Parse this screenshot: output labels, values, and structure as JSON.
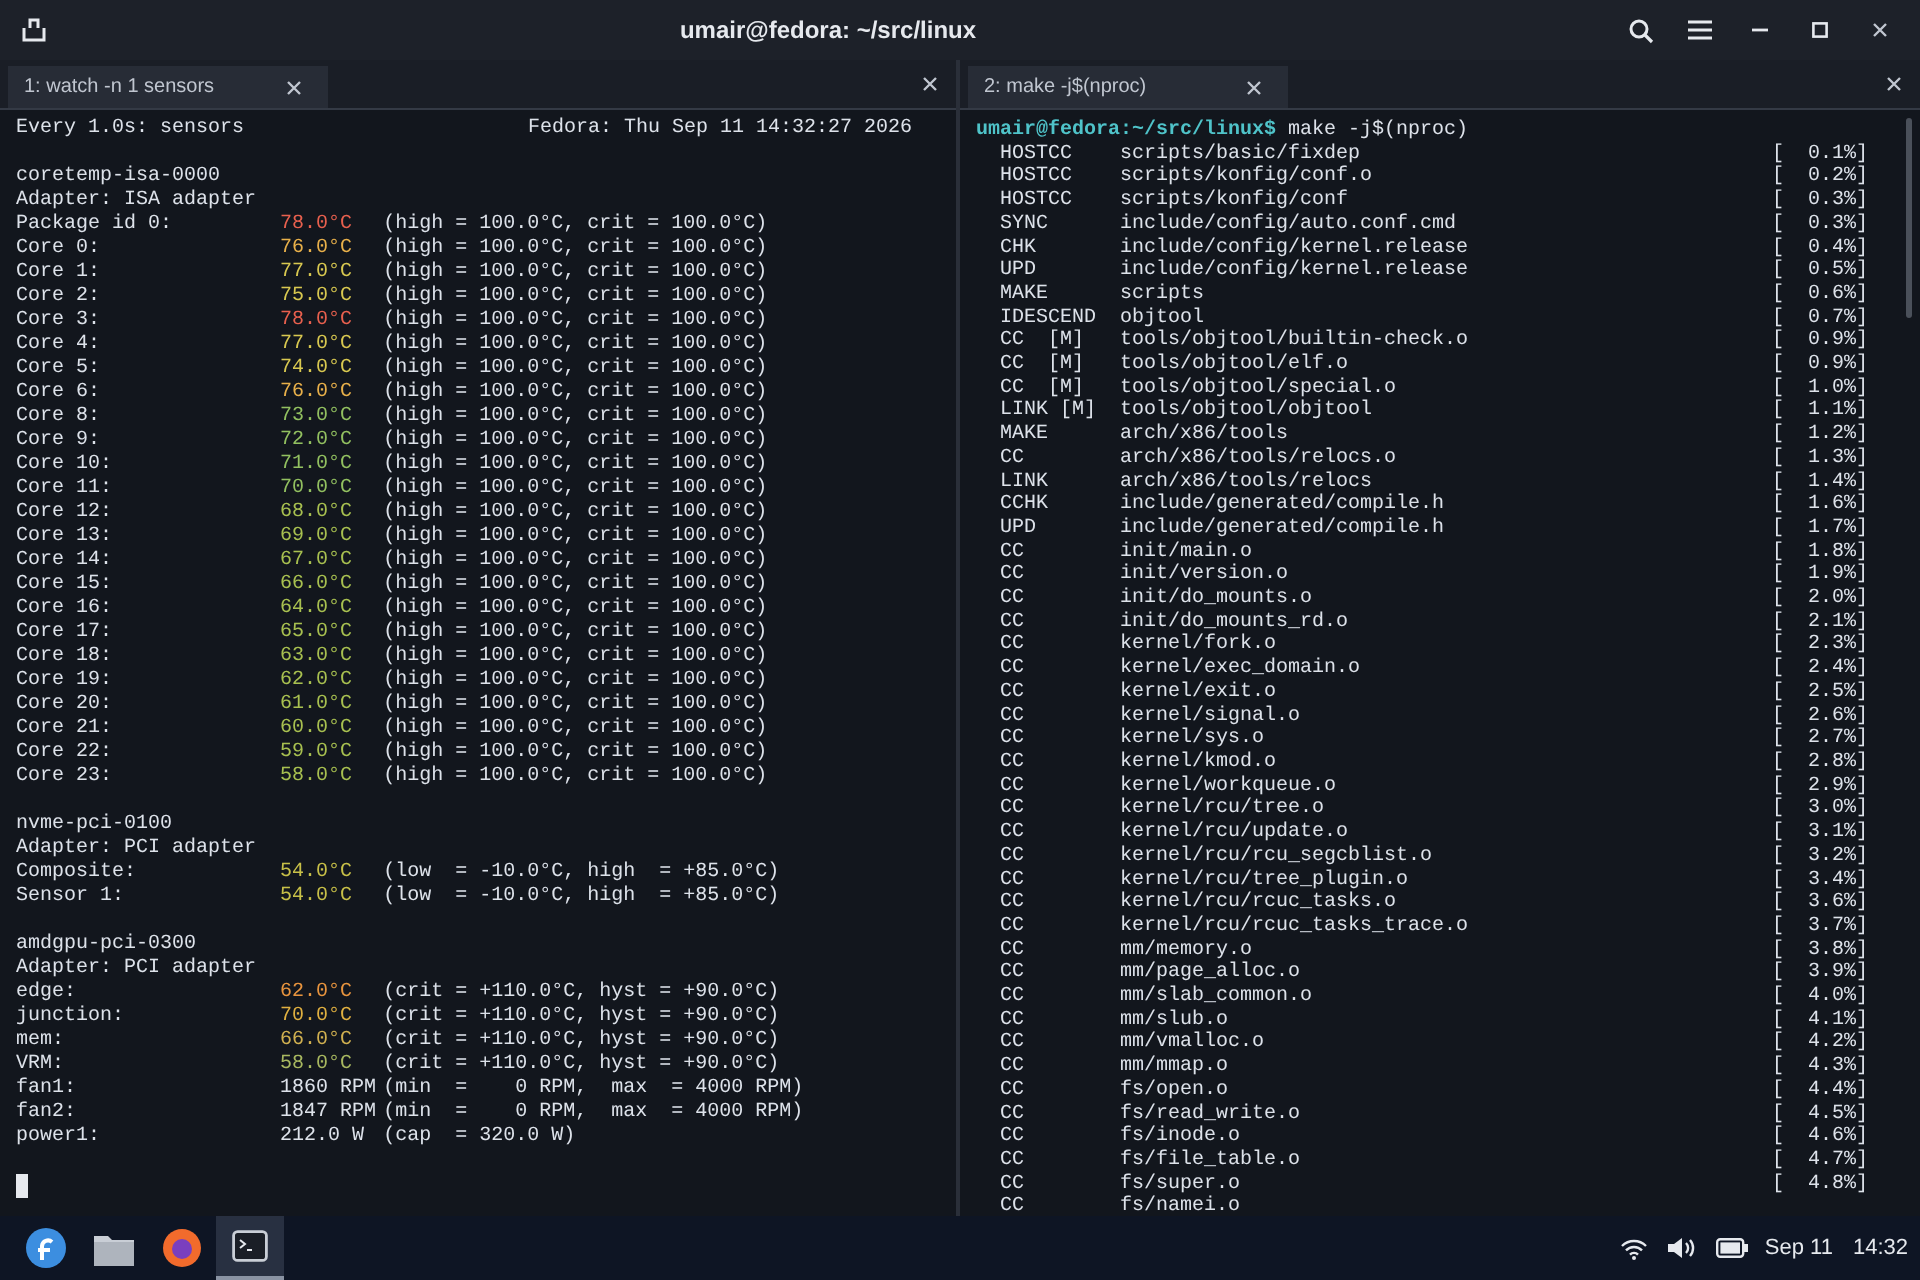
{
  "window": {
    "title": "umair@fedora: ~/src/linux"
  },
  "left_pane": {
    "tab": {
      "label": "1: watch -n 1 sensors"
    },
    "header": {
      "command": "Every 1.0s: sensors",
      "timestamp": "Fedora: Thu Sep 11 14:32:27 2026"
    },
    "sections": [
      {
        "chip": "coretemp-isa-0000",
        "adapter": "Adapter: ISA adapter",
        "readings": [
          {
            "label": "Package id 0:",
            "value": "78.0°C",
            "color": "#e8604e",
            "detail": "(high = 100.0°C, crit = 100.0°C)"
          },
          {
            "label": "Core 0:",
            "value": "76.0°C",
            "color": "#e8b04a",
            "detail": "(high = 100.0°C, crit = 100.0°C)"
          },
          {
            "label": "Core 1:",
            "value": "77.0°C",
            "color": "#d8c850",
            "detail": "(high = 100.0°C, crit = 100.0°C)"
          },
          {
            "label": "Core 2:",
            "value": "75.0°C",
            "color": "#d8c850",
            "detail": "(high = 100.0°C, crit = 100.0°C)"
          },
          {
            "label": "Core 3:",
            "value": "78.0°C",
            "color": "#e8604e",
            "detail": "(high = 100.0°C, crit = 100.0°C)"
          },
          {
            "label": "Core 4:",
            "value": "77.0°C",
            "color": "#d8c850",
            "detail": "(high = 100.0°C, crit = 100.0°C)"
          },
          {
            "label": "Core 5:",
            "value": "74.0°C",
            "color": "#d8c850",
            "detail": "(high = 100.0°C, crit = 100.0°C)"
          },
          {
            "label": "Core 6:",
            "value": "76.0°C",
            "color": "#e8b04a",
            "detail": "(high = 100.0°C, crit = 100.0°C)"
          },
          {
            "label": "Core 8:",
            "value": "73.0°C",
            "color": "#92c060",
            "detail": "(high = 100.0°C, crit = 100.0°C)"
          },
          {
            "label": "Core 9:",
            "value": "72.0°C",
            "color": "#92c060",
            "detail": "(high = 100.0°C, crit = 100.0°C)"
          },
          {
            "label": "Core 10:",
            "value": "71.0°C",
            "color": "#92c060",
            "detail": "(high = 100.0°C, crit = 100.0°C)"
          },
          {
            "label": "Core 11:",
            "value": "70.0°C",
            "color": "#92c060",
            "detail": "(high = 100.0°C, crit = 100.0°C)"
          },
          {
            "label": "Core 12:",
            "value": "68.0°C",
            "color": "#a8c050",
            "detail": "(high = 100.0°C, crit = 100.0°C)"
          },
          {
            "label": "Core 13:",
            "value": "69.0°C",
            "color": "#a8c050",
            "detail": "(high = 100.0°C, crit = 100.0°C)"
          },
          {
            "label": "Core 14:",
            "value": "67.0°C",
            "color": "#a8c050",
            "detail": "(high = 100.0°C, crit = 100.0°C)"
          },
          {
            "label": "Core 15:",
            "value": "66.0°C",
            "color": "#a8c050",
            "detail": "(high = 100.0°C, crit = 100.0°C)"
          },
          {
            "label": "Core 16:",
            "value": "64.0°C",
            "color": "#a8c050",
            "detail": "(high = 100.0°C, crit = 100.0°C)"
          },
          {
            "label": "Core 17:",
            "value": "65.0°C",
            "color": "#a8c050",
            "detail": "(high = 100.0°C, crit = 100.0°C)"
          },
          {
            "label": "Core 18:",
            "value": "63.0°C",
            "color": "#a8c050",
            "detail": "(high = 100.0°C, crit = 100.0°C)"
          },
          {
            "label": "Core 19:",
            "value": "62.0°C",
            "color": "#a8c050",
            "detail": "(high = 100.0°C, crit = 100.0°C)"
          },
          {
            "label": "Core 20:",
            "value": "61.0°C",
            "color": "#a8c050",
            "detail": "(high = 100.0°C, crit = 100.0°C)"
          },
          {
            "label": "Core 21:",
            "value": "60.0°C",
            "color": "#a8c050",
            "detail": "(high = 100.0°C, crit = 100.0°C)"
          },
          {
            "label": "Core 22:",
            "value": "59.0°C",
            "color": "#a8c050",
            "detail": "(high = 100.0°C, crit = 100.0°C)"
          },
          {
            "label": "Core 23:",
            "value": "58.0°C",
            "color": "#a8c050",
            "detail": "(high = 100.0°C, crit = 100.0°C)"
          }
        ]
      },
      {
        "chip": "nvme-pci-0100",
        "adapter": "Adapter: PCI adapter",
        "readings": [
          {
            "label": "Composite:",
            "value": "54.0°C",
            "color": "#c8c048",
            "detail": "(low  = -10.0°C, high  = +85.0°C)"
          },
          {
            "label": "Sensor 1:",
            "value": "54.0°C",
            "color": "#c8c048",
            "detail": "(low  = -10.0°C, high  = +85.0°C)"
          }
        ]
      },
      {
        "chip": "amdgpu-pci-0300",
        "adapter": "Adapter: PCI adapter",
        "readings": [
          {
            "label": "edge:",
            "value": "62.0°C",
            "color": "#e8943e",
            "detail": "(crit = +110.0°C, hyst = +90.0°C)"
          },
          {
            "label": "junction:",
            "value": "70.0°C",
            "color": "#e0b040",
            "detail": "(crit = +110.0°C, hyst = +90.0°C)"
          },
          {
            "label": "mem:",
            "value": "66.0°C",
            "color": "#d0b050",
            "detail": "(crit = +110.0°C, hyst = +90.0°C)"
          },
          {
            "label": "VRM:",
            "value": "58.0°C",
            "color": "#a8b860",
            "detail": "(crit = +110.0°C, hyst = +90.0°C)"
          },
          {
            "label": "fan1:",
            "value": "1860 RPM",
            "detail": "(min  =    0 RPM,  max  = 4000 RPM)"
          },
          {
            "label": "fan2:",
            "value": "1847 RPM",
            "detail": "(min  =    0 RPM,  max  = 4000 RPM)"
          },
          {
            "label": "power1:",
            "value": "212.0 W",
            "detail": "(cap  = 320.0 W)"
          }
        ]
      }
    ]
  },
  "right_pane": {
    "tab": {
      "label": "2: make -j$(nproc)"
    },
    "prompt": "umair@fedora:~/src/linux$",
    "command": "make -j$(nproc)",
    "lines": [
      {
        "tag": "HOSTCC",
        "path": "scripts/basic/fixdep",
        "progress": "[  0.1%]"
      },
      {
        "tag": "HOSTCC",
        "path": "scripts/konfig/conf.o",
        "progress": "[  0.2%]"
      },
      {
        "tag": "HOSTCC",
        "path": "scripts/konfig/conf",
        "progress": "[  0.3%]"
      },
      {
        "tag": "SYNC",
        "path": "include/config/auto.conf.cmd",
        "progress": "[  0.3%]"
      },
      {
        "tag": "CHK",
        "path": "include/config/kernel.release",
        "progress": "[  0.4%]"
      },
      {
        "tag": "UPD",
        "path": "include/config/kernel.release",
        "progress": "[  0.5%]"
      },
      {
        "tag": "MAKE",
        "path": "scripts",
        "progress": "[  0.6%]"
      },
      {
        "tag": "IDESCEND",
        "path": "objtool",
        "progress": "[  0.7%]"
      },
      {
        "tag": "CC  [M]",
        "path": "tools/objtool/builtin-check.o",
        "progress": "[  0.9%]"
      },
      {
        "tag": "CC  [M]",
        "path": "tools/objtool/elf.o",
        "progress": "[  0.9%]"
      },
      {
        "tag": "CC  [M]",
        "path": "tools/objtool/special.o",
        "progress": "[  1.0%]"
      },
      {
        "tag": "LINK [M]",
        "path": "tools/objtool/objtool",
        "progress": "[  1.1%]"
      },
      {
        "tag": "MAKE",
        "path": "arch/x86/tools",
        "progress": "[  1.2%]"
      },
      {
        "tag": "CC",
        "path": "arch/x86/tools/relocs.o",
        "progress": "[  1.3%]"
      },
      {
        "tag": "LINK",
        "path": "arch/x86/tools/relocs",
        "progress": "[  1.4%]"
      },
      {
        "tag": "CCHK",
        "path": "include/generated/compile.h",
        "progress": "[  1.6%]"
      },
      {
        "tag": "UPD",
        "path": "include/generated/compile.h",
        "progress": "[  1.7%]"
      },
      {
        "tag": "CC",
        "path": "init/main.o",
        "progress": "[  1.8%]"
      },
      {
        "tag": "CC",
        "path": "init/version.o",
        "progress": "[  1.9%]"
      },
      {
        "tag": "CC",
        "path": "init/do_mounts.o",
        "progress": "[  2.0%]"
      },
      {
        "tag": "CC",
        "path": "init/do_mounts_rd.o",
        "progress": "[  2.1%]"
      },
      {
        "tag": "CC",
        "path": "kernel/fork.o",
        "progress": "[  2.3%]"
      },
      {
        "tag": "CC",
        "path": "kernel/exec_domain.o",
        "progress": "[  2.4%]"
      },
      {
        "tag": "CC",
        "path": "kernel/exit.o",
        "progress": "[  2.5%]"
      },
      {
        "tag": "CC",
        "path": "kernel/signal.o",
        "progress": "[  2.6%]"
      },
      {
        "tag": "CC",
        "path": "kernel/sys.o",
        "progress": "[  2.7%]"
      },
      {
        "tag": "CC",
        "path": "kernel/kmod.o",
        "progress": "[  2.8%]"
      },
      {
        "tag": "CC",
        "path": "kernel/workqueue.o",
        "progress": "[  2.9%]"
      },
      {
        "tag": "CC",
        "path": "kernel/rcu/tree.o",
        "progress": "[  3.0%]"
      },
      {
        "tag": "CC",
        "path": "kernel/rcu/update.o",
        "progress": "[  3.1%]"
      },
      {
        "tag": "CC",
        "path": "kernel/rcu/rcu_segcblist.o",
        "progress": "[  3.2%]"
      },
      {
        "tag": "CC",
        "path": "kernel/rcu/tree_plugin.o",
        "progress": "[  3.4%]"
      },
      {
        "tag": "CC",
        "path": "kernel/rcu/rcuc_tasks.o",
        "progress": "[  3.6%]"
      },
      {
        "tag": "CC",
        "path": "kernel/rcu/rcuc_tasks_trace.o",
        "progress": "[  3.7%]"
      },
      {
        "tag": "CC",
        "path": "mm/memory.o",
        "progress": "[  3.8%]"
      },
      {
        "tag": "CC",
        "path": "mm/page_alloc.o",
        "progress": "[  3.9%]"
      },
      {
        "tag": "CC",
        "path": "mm/slab_common.o",
        "progress": "[  4.0%]"
      },
      {
        "tag": "CC",
        "path": "mm/slub.o",
        "progress": "[  4.1%]"
      },
      {
        "tag": "CC",
        "path": "mm/vmalloc.o",
        "progress": "[  4.2%]"
      },
      {
        "tag": "CC",
        "path": "mm/mmap.o",
        "progress": "[  4.3%]"
      },
      {
        "tag": "CC",
        "path": "fs/open.o",
        "progress": "[  4.4%]"
      },
      {
        "tag": "CC",
        "path": "fs/read_write.o",
        "progress": "[  4.5%]"
      },
      {
        "tag": "CC",
        "path": "fs/inode.o",
        "progress": "[  4.6%]"
      },
      {
        "tag": "CC",
        "path": "fs/file_table.o",
        "progress": "[  4.7%]"
      },
      {
        "tag": "CC",
        "path": "fs/super.o",
        "progress": "[  4.8%]"
      },
      {
        "tag": "CC",
        "path": "fs/namei.o"
      }
    ]
  },
  "taskbar": {
    "date": "Sep 11",
    "time": "14:32"
  }
}
